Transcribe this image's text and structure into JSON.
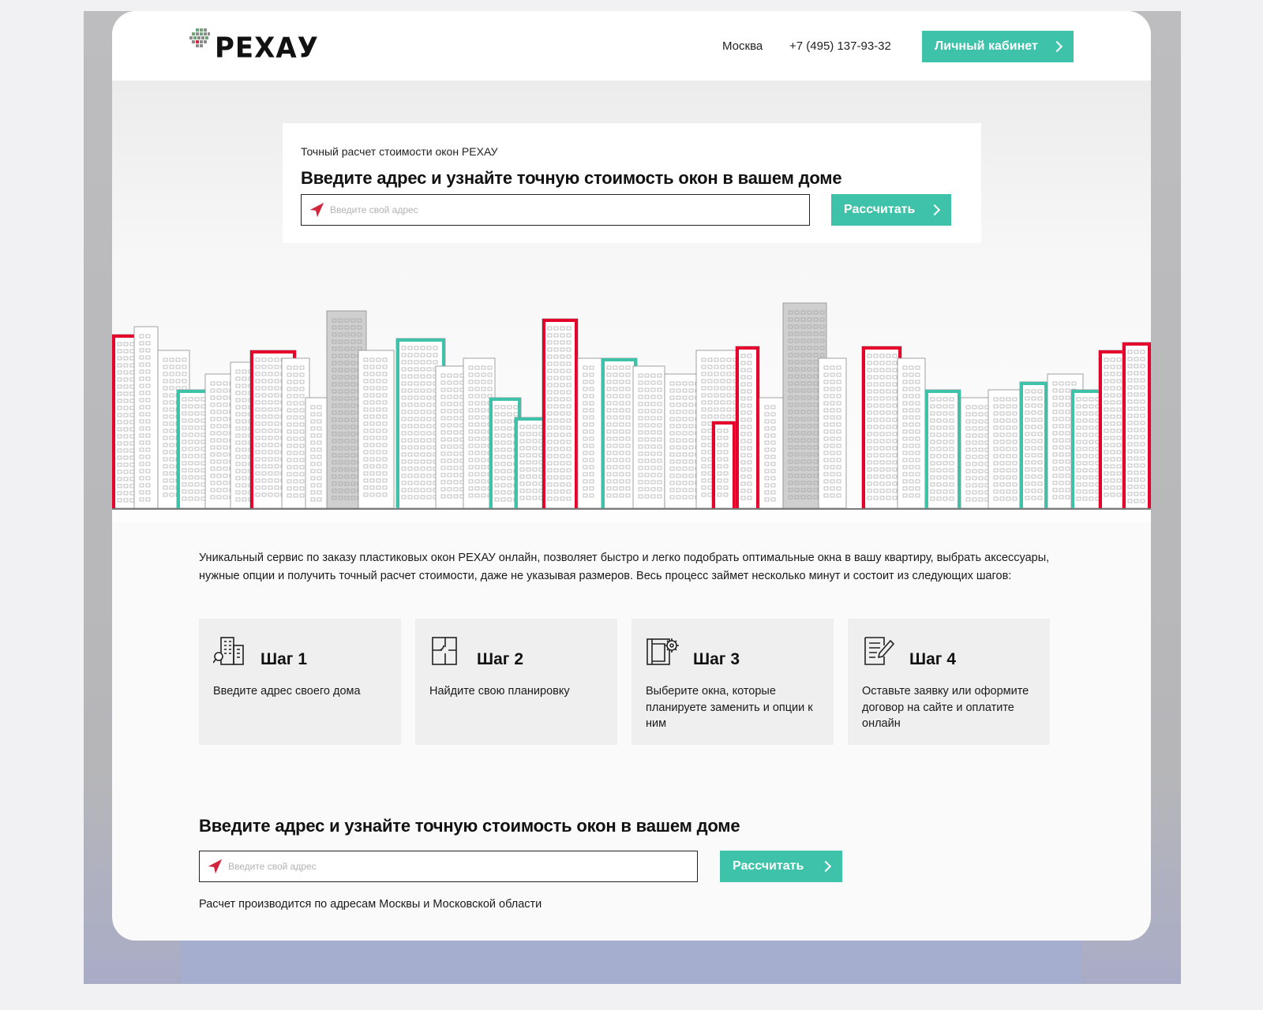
{
  "header": {
    "logo_text": "РЕХАУ",
    "city": "Москва",
    "phone": "+7 (495) 137-93-32",
    "account_label": "Личный кабинет"
  },
  "hero": {
    "subtitle": "Точный расчет стоимости окон РЕХАУ",
    "title": "Введите адрес и узнайте точную стоимость окон в вашем доме",
    "address_placeholder": "Введите свой адрес",
    "calculate_label": "Рассчитать"
  },
  "intro": {
    "text": "Уникальный сервис по заказу пластиковых окон РЕХАУ онлайн, позволяет быстро и легко подобрать оптимальные окна в вашу квартиру, выбрать аксессуары, нужные опции и получить точный расчет стоимости, даже не указывая размеров. Весь процесс займет несколько минут и состоит из следующих шагов:"
  },
  "steps": [
    {
      "title": "Шаг 1",
      "text": "Введите адрес своего дома",
      "icon": "building-search-icon"
    },
    {
      "title": "Шаг 2",
      "text": "Найдите свою планировку",
      "icon": "floor-plan-icon"
    },
    {
      "title": "Шаг 3",
      "text": "Выберите окна, которые планируете заменить и опции к ним",
      "icon": "window-settings-icon"
    },
    {
      "title": "Шаг 4",
      "text": "Оставьте заявку или оформите договор на сайте и оплатите онлайн",
      "icon": "document-edit-icon"
    }
  ],
  "bottom": {
    "title": "Введите адрес и узнайте точную стоимость окон в вашем доме",
    "address_placeholder": "Введите свой адрес",
    "calculate_label": "Рассчитать",
    "note": "Расчет производится по адресам Москвы и Московской области"
  },
  "colors": {
    "accent": "#3ec2a9",
    "brand_red": "#e4002b",
    "text": "#111111"
  }
}
